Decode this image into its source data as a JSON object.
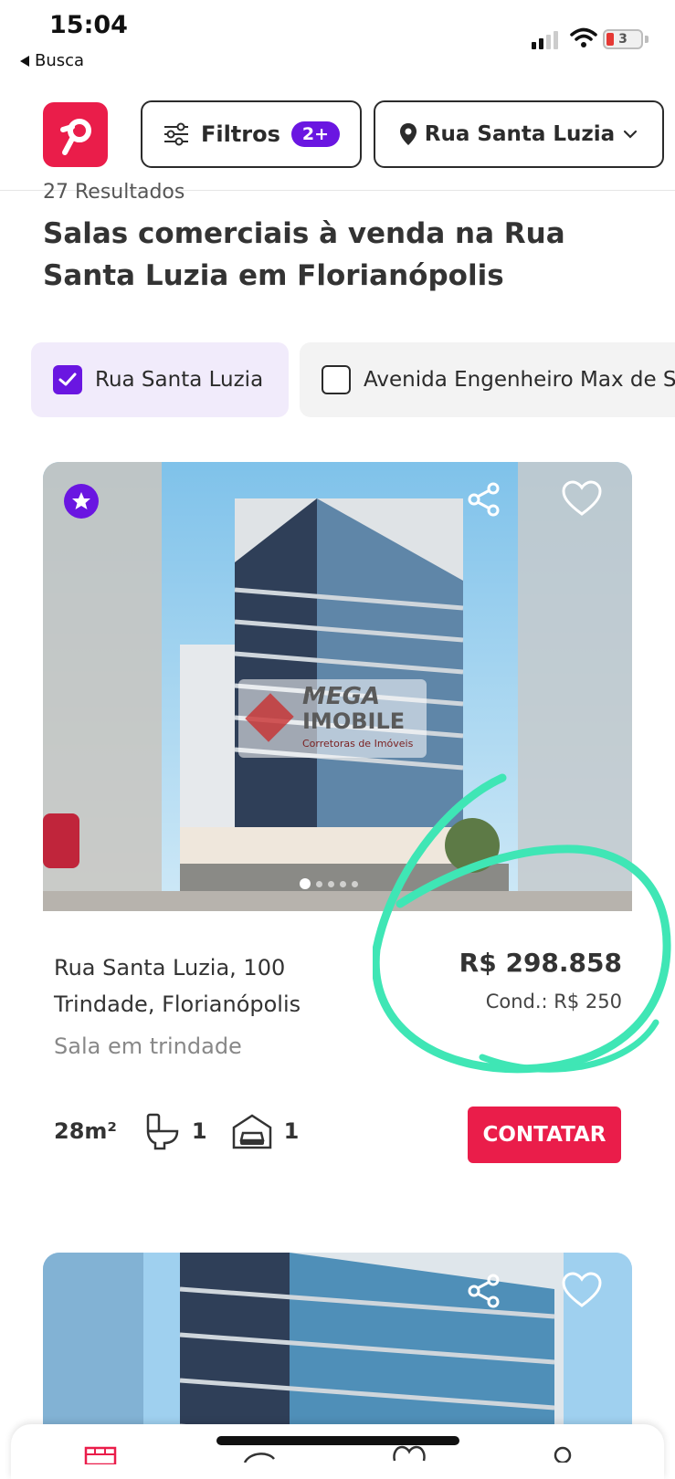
{
  "status_bar": {
    "time": "15:04",
    "back_label": "Busca",
    "battery": "3"
  },
  "header": {
    "filter_label": "Filtros",
    "filter_badge": "2+",
    "location_label": "Rua Santa Luzia"
  },
  "results": {
    "count_text": "27 Resultados",
    "title": "Salas comerciais à venda na Rua Santa Luzia em Florianópolis"
  },
  "chips": [
    {
      "label": "Rua Santa Luzia",
      "checked": true
    },
    {
      "label": "Avenida Engenheiro Max de S",
      "checked": false
    }
  ],
  "listing": {
    "watermark_line1": "MEGA",
    "watermark_line2": "IMOBILE",
    "watermark_line3": "Corretoras de Imóveis",
    "address_line1": "Rua Santa Luzia, 100",
    "address_line2": "Trindade, Florianópolis",
    "subtitle": "Sala em trindade",
    "price": "R$ 298.858",
    "condo": "Cond.: R$ 250",
    "area": "28m²",
    "bathrooms": "1",
    "parking": "1",
    "contact_label": "CONTATAR",
    "image_index": 1,
    "image_total": 5
  },
  "colors": {
    "brand_red": "#ea1d4a",
    "accent_purple": "#6a16e1",
    "highlight_green": "#3fe6b5"
  }
}
